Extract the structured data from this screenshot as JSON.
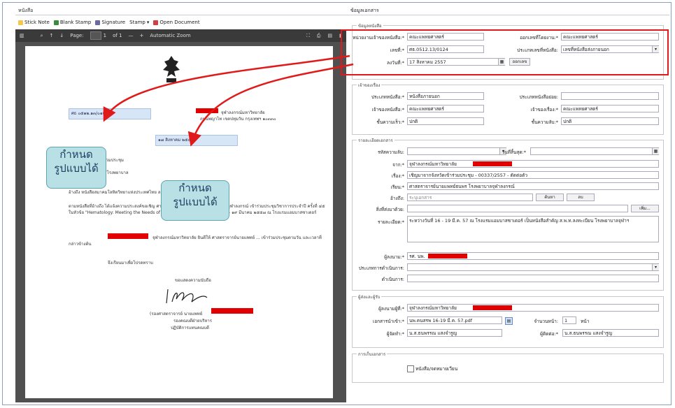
{
  "left_pane": {
    "title": "หนังสือ",
    "toolbar": {
      "sticky_note": "Stick Note",
      "blank_stamp": "Blank Stamp",
      "signature": "Signature",
      "stamp": "Stamp",
      "open_document": "Open Document"
    },
    "pdf_viewer": {
      "page_label": "Page:",
      "page_value": "1",
      "page_total": "of 1",
      "zoom": "Automatic Zoom"
    },
    "document": {
      "doc_no_field": "ศธ ๐๕๑๒.๑๓/๐๑๒๔",
      "date_field": "๑๗ สิงหาคม ๒๕๕๗",
      "header_right_1": "จุฬาลงกรณ์มหาวิทยาลัย",
      "header_right_2": "ถนนพญาไท เขตปทุมวัน กรุงเทพฯ ๑๐๓๓๐",
      "line_meeting": "เรื่อง ขอเชิญเข้าร่วมประชุม",
      "line_to": "เรียน ผู้อำนวยการโรงพยาบาล",
      "line_ref": "อ้างถึง หนังสือสมาคมโลหิตวิทยาแห่งประเทศไทย ลงวันที่ ๕ ธันวาคม ๒๕๕๖",
      "para1": "ตามหนังสือที่อ้างถึง ได้แจ้งความประสงค์ขอเชิญ ศาสตราจารย์นายแพทย์ ... โรงพยาบาลจุฬาลงกรณ์ เข้าร่วมประชุมวิชาการประจำปี ครั้งที่ ๔๕ ในหัวข้อ \"Hematology: Meeting the Needs of Changing World\" ระหว่างวันที่ ๑๖ – ๑๙ มีนาคม ๒๕๕๗ ณ โรงแรมแอมบาสซาเดอร์",
      "para2": "จุฬาลงกรณ์มหาวิทยาลัย ยินดีให้ ศาสตราจารย์นายแพทย์ ... เข้าร่วมประชุมตามวัน และเวลาที่กล่าวข้างต้น",
      "closing": "จึงเรียนมาเพื่อโปรดทราบ",
      "regards": "ขอแสดงความนับถือ",
      "signature_title": "(รองศาสตราจารย์ นายแพทย์",
      "sig_line2": "รองคณบดีฝ่ายบริหาร",
      "sig_line3": "ปฏิบัติการแทนคณบดี"
    },
    "callouts": [
      "กำหนด",
      "รูปแบบได้",
      "กำหนด",
      "รูปแบบได้"
    ]
  },
  "right_pane": {
    "title": "ข้อมูลเอกสาร",
    "section_doc": {
      "header": "ข้อมูลหนังสือ",
      "owner_label": "หน่วยงานเจ้าของหนังสือ:*",
      "owner_value": "คณะแพทยศาสตร์",
      "rec_owner_label": "ออกเลขที่โดยงาน:*",
      "rec_owner_value": "คณะแพทยศาสตร์",
      "docno_label": "เลขที่:*",
      "docno_value": "ศธ.0512.13/0124",
      "doctype_label": "ประเภทเลขที่หนังสือ:",
      "doctype_value": "เลขที่หนังสือส่งภายนอก",
      "date_label": "ลงวันที่:*",
      "date_value": "17 สิงหาคม 2557",
      "reserve_button": "ออกเลข"
    },
    "section_owner": {
      "header": "เจ้าของเรื่อง",
      "type_label": "ประเภทหนังสือ:*",
      "type_value": "หนังสือภายนอก",
      "subtype_label": "ประเภทหนังสือย่อย:",
      "subtype_value": "",
      "owner_label": "เจ้าของหนังสือ:*",
      "owner_value": "คณะแพทยศาสตร์",
      "story_owner_label": "เจ้าของเรื่อง:*",
      "story_owner_value": "คณะแพทยศาสตร์",
      "speed_label": "ชั้นความเร็ว:*",
      "speed_value": "ปกติ",
      "secret_label": "ชั้นความลับ:*",
      "secret_value": "ปกติ"
    },
    "section_detail": {
      "header": "รายละเอียดเอกสาร",
      "sendtype_label": "รหัสความลับ:",
      "sendtype_value": "",
      "expire_label": "วันที่สิ้นสุด:*",
      "expire_value": "",
      "from_label": "จาก:*",
      "from_value": "จุฬาลงกรณ์มหาวิทยาลัย",
      "subject_label": "เรื่อง:*",
      "subject_value": "เชิญมาจากจังหวัดเข้าร่วมประชุม - 00337/2557 - ตัดต่อตัว",
      "to_label": "เรียน:*",
      "to_value": "ศาสตราจารย์นายแพทย์ธนพร โรงพยาบาลจุฬาลงกรณ์",
      "ref_label": "อ้างถึง:",
      "ref_value": "ระบุเอกสาร",
      "search_button": "ค้นหา",
      "clear_button": "ลบ",
      "attach_label": "สิ่งที่ส่งมาด้วย:",
      "attach_button": "เพิ่ม...",
      "summary_label": "รายละเอียด:*",
      "summary_value": "ระหว่างวันที่ 16 - 19 มี.ค. 57 ณ โรงแรมแอมบาสซาเดอร์ เป็นหนังสือสำคัญ ส.พ.ท.ลงทะเบียน โรงพยาบาลจุฬาฯ",
      "signer_label": "ผู้ลงนาม:*",
      "signer_value": "รศ. นพ.",
      "action_label": "ประเภทการดำเนินการ:",
      "action_value": "",
      "note_label": "ดำเนินการ:",
      "note_value": ""
    },
    "section_sender": {
      "header": "ผู้ส่งและผู้รับ",
      "sender_label": "ผู้ลงนามผู้ที่:*",
      "sender_value": "จุฬาลงกรณ์มหาวิทยาลัย",
      "file_label": "เอกสารนำเข้า:*",
      "file_value": "นพ.คนสรพ 16-19 มี.ค. 57.pdf",
      "pages_label": "จำนวนหน้า:",
      "pages_value": "1",
      "pages_unit": "หน้า",
      "creator_label": "ผู้จัดทำ:*",
      "creator_value": "น.ส.ธนพรรณ แสงจำรูญ",
      "editor_label": "ผู้ติดต่อ:*",
      "editor_value": "น.ส.ธนพรรณ แสงจำรูญ"
    },
    "section_extra": {
      "header": "การเก็บเอกสาร",
      "checkbox_label": "หนังสือ/จดหมายเวียน"
    }
  },
  "colors": {
    "highlight_red": "#e01a1a",
    "callout_fill": "#b9e0e5",
    "field_blue": "#d7e6f7"
  }
}
